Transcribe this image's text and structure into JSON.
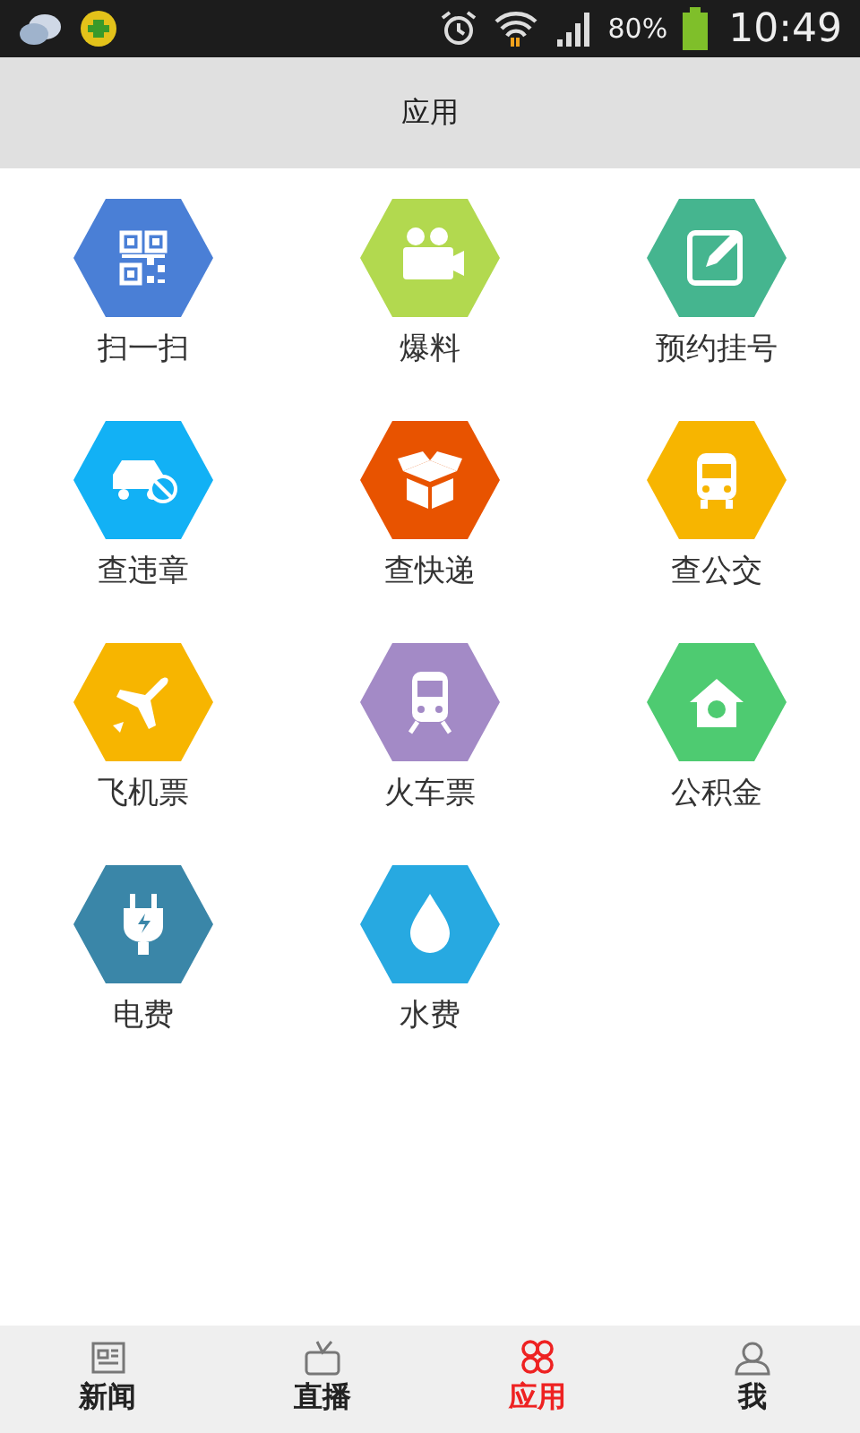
{
  "status_bar": {
    "battery": "80%",
    "time": "10:49"
  },
  "header": {
    "title": "应用"
  },
  "apps": [
    {
      "label": "扫一扫",
      "kind": "qr",
      "color": "#4a7fd6"
    },
    {
      "label": "爆料",
      "kind": "camera",
      "color": "#b2d94f"
    },
    {
      "label": "预约挂号",
      "kind": "edit",
      "color": "#45b58f"
    },
    {
      "label": "查违章",
      "kind": "car",
      "color": "#12b1f5"
    },
    {
      "label": "查快递",
      "kind": "box",
      "color": "#e85300"
    },
    {
      "label": "查公交",
      "kind": "bus",
      "color": "#f7b500"
    },
    {
      "label": "飞机票",
      "kind": "plane",
      "color": "#f7b500"
    },
    {
      "label": "火车票",
      "kind": "train",
      "color": "#a38ac6"
    },
    {
      "label": "公积金",
      "kind": "house",
      "color": "#4ecb71"
    },
    {
      "label": "电费",
      "kind": "plug",
      "color": "#3a86a8"
    },
    {
      "label": "水费",
      "kind": "drop",
      "color": "#27a9e1"
    }
  ],
  "tabs": [
    {
      "label": "新闻",
      "kind": "news",
      "selected": false
    },
    {
      "label": "直播",
      "kind": "tv",
      "selected": false
    },
    {
      "label": "应用",
      "kind": "apps",
      "selected": true
    },
    {
      "label": "我",
      "kind": "user",
      "selected": false
    }
  ]
}
